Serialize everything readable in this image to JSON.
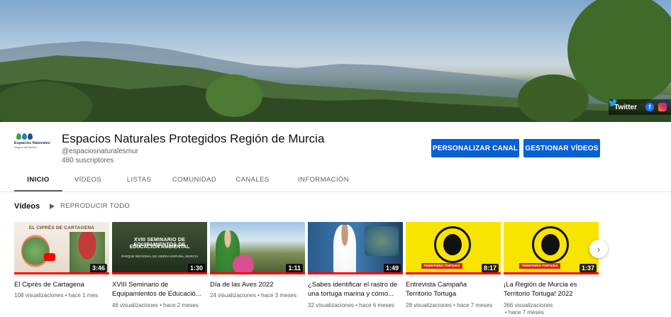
{
  "banner": {
    "social": {
      "twitter_label": "Twitter",
      "twitter_icon": "twitter-icon",
      "facebook_icon": "facebook-icon",
      "instagram_icon": "instagram-icon",
      "facebook_glyph": "f"
    }
  },
  "channel": {
    "logo_text": "Espacios Naturales",
    "logo_sub": "Región de Murcia",
    "title": "Espacios Naturales Protegidos Región de Murcia",
    "handle": "@espaciosnaturalesmur",
    "subscribers": "480 suscriptores",
    "customize_label": "PERSONALIZAR CANAL",
    "manage_label": "GESTIONAR VÍDEOS",
    "accent_color": "#065fd4"
  },
  "tabs": [
    {
      "label": "INICIO",
      "active": true
    },
    {
      "label": "VÍDEOS",
      "active": false
    },
    {
      "label": "LISTAS",
      "active": false
    },
    {
      "label": "COMUNIDAD",
      "active": false
    },
    {
      "label": "CANALES",
      "active": false
    },
    {
      "label": "INFORMACIÓN",
      "active": false
    }
  ],
  "section": {
    "title": "Vídeos",
    "play_all_label": "REPRODUCIR TODO"
  },
  "videos": [
    {
      "title_line1": "El Ciprés de Cartagena",
      "title_line2": "",
      "meta_line1": "108 visualizaciones • hace 1 mes",
      "meta_line2": "",
      "duration": "3:46",
      "thumb_text": "EL CIPRÉS DE CARTAGENA",
      "watched_fraction": 1.0
    },
    {
      "title_line1": "XVIII Seminario de",
      "title_line2": "Equipamientos de Educació...",
      "meta_line1": "46 visualizaciones • hace 2 meses",
      "meta_line2": "",
      "duration": "1:30",
      "thumb_text_1": "XVIII SEMINARIO DE EQUIPAMIENTOS DE",
      "thumb_text_2": "EDUCACIÓN AMBIENTAL",
      "thumb_text_3": "PARQUE REGIONAL DE SIERRA ESPUÑA, MURCIA",
      "watched_fraction": 1.0
    },
    {
      "title_line1": "Día de las Aves 2022",
      "title_line2": "",
      "meta_line1": "24 visualizaciones • hace 3 meses",
      "meta_line2": "",
      "duration": "1:11",
      "watched_fraction": 1.0
    },
    {
      "title_line1": "¿Sabes identificar el rastro de",
      "title_line2": "una tortuga marina y cómo...",
      "meta_line1": "32 visualizaciones • hace 6 meses",
      "meta_line2": "",
      "duration": "1:49",
      "watched_fraction": 1.0
    },
    {
      "title_line1": "Entrevista Campaña",
      "title_line2": "Territorio Tortuga",
      "meta_line1": "28 visualizaciones • hace 7 meses",
      "meta_line2": "",
      "duration": "8:17",
      "thumb_text": "TERRITORIO TORTUGA",
      "watched_fraction": 1.0
    },
    {
      "title_line1": "¡La Región de Murcia es",
      "title_line2": "Territorio Tortuga! 2022",
      "meta_line1": "366 visualizaciones",
      "meta_line2": "• hace 7 meses",
      "duration": "1:37",
      "thumb_text": "TERRITORIO TORTUGA",
      "watched_fraction": 1.0
    }
  ],
  "carousel": {
    "next_glyph": "›",
    "next_icon": "chevron-right-icon"
  }
}
